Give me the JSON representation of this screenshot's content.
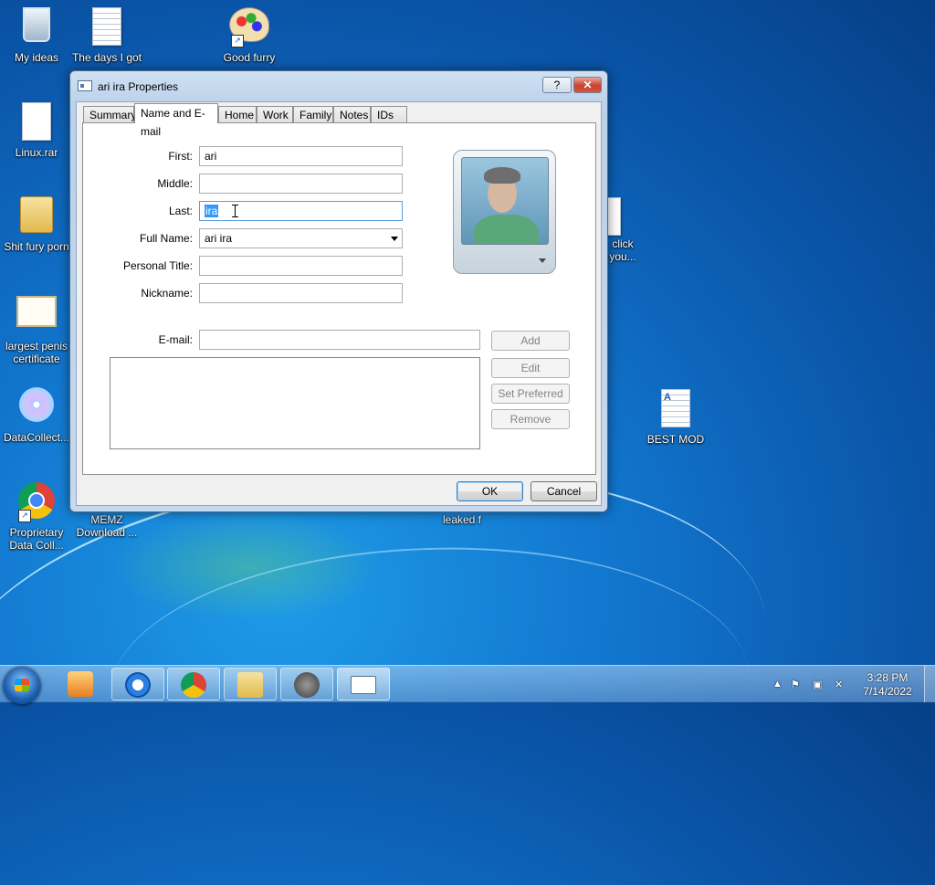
{
  "desktop": {
    "icons": [
      {
        "label": "My ideas",
        "icon": "recycle-bin-icon"
      },
      {
        "label": "The days I got",
        "icon": "text-document-icon"
      },
      {
        "label": "Good furry",
        "icon": "paint-palette-icon"
      },
      {
        "label": "Linux.rar",
        "icon": "blank-file-icon"
      },
      {
        "label": "Shit fury porn",
        "icon": "folder-icon"
      },
      {
        "label": "largest penis certificate",
        "icon": "certificate-icon"
      },
      {
        "label": "DataCollect...",
        "icon": "installer-disc-icon"
      },
      {
        "label": "Proprietary Data Coll...",
        "icon": "chrome-icon"
      },
      {
        "label": "MEMZ Download ...",
        "icon": "shortcut-icon"
      },
      {
        "label": "leaked f",
        "icon": "file-icon"
      },
      {
        "label": "click you...",
        "icon": "file-icon"
      },
      {
        "label": "BEST MOD",
        "icon": "word-document-icon"
      }
    ]
  },
  "dialog": {
    "title": "ari ira Properties",
    "help_button": "?",
    "close_button": "✕",
    "tabs": [
      {
        "label": "Summary",
        "active": false
      },
      {
        "label": "Name and E-mail",
        "active": true
      },
      {
        "label": "Home",
        "active": false
      },
      {
        "label": "Work",
        "active": false
      },
      {
        "label": "Family",
        "active": false
      },
      {
        "label": "Notes",
        "active": false
      },
      {
        "label": "IDs",
        "active": false
      }
    ],
    "fields": {
      "first": {
        "label": "First:",
        "value": "ari"
      },
      "middle": {
        "label": "Middle:",
        "value": ""
      },
      "last": {
        "label": "Last:",
        "value": "ira"
      },
      "full_name": {
        "label": "Full Name:",
        "value": "ari ira"
      },
      "personal_title": {
        "label": "Personal Title:",
        "value": ""
      },
      "nickname": {
        "label": "Nickname:",
        "value": ""
      },
      "email": {
        "label": "E-mail:",
        "value": ""
      }
    },
    "email_buttons": {
      "add": "Add",
      "edit": "Edit",
      "set_preferred": "Set Preferred",
      "remove": "Remove"
    },
    "ok_label": "OK",
    "cancel_label": "Cancel"
  },
  "taskbar": {
    "time": "3:28 PM",
    "date": "7/14/2022"
  }
}
